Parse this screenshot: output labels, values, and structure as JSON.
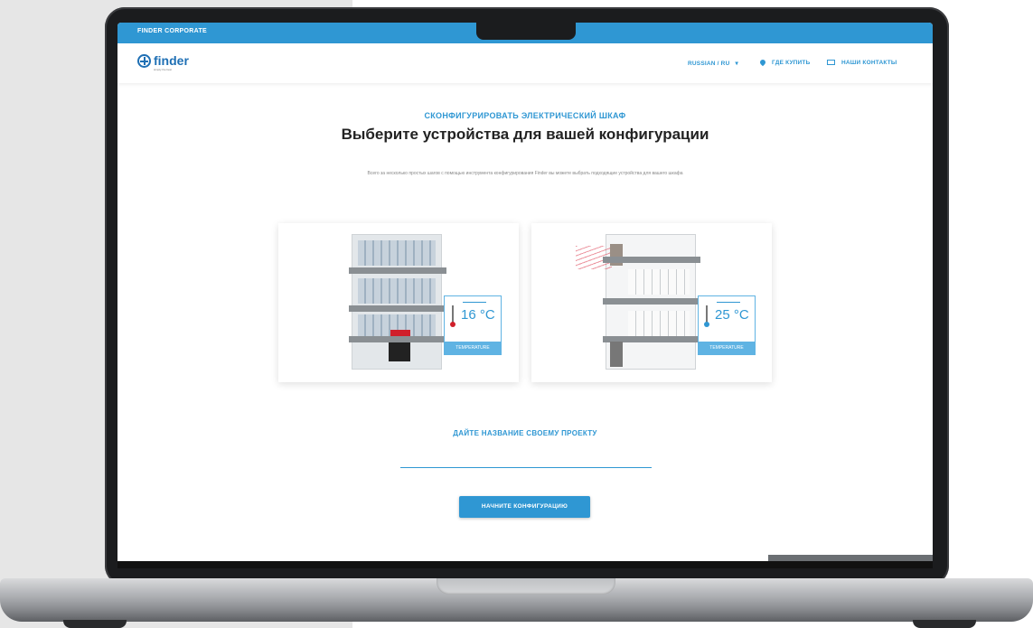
{
  "topbar": {
    "title": "FINDER CORPORATE"
  },
  "header": {
    "logo_text": "finder",
    "logo_tagline": "simply the best",
    "nav": {
      "language": "RUSSIAN / RU",
      "language_chevron": "▾",
      "where_to_buy": "ГДЕ КУПИТЬ",
      "contacts": "НАШИ КОНТАКТЫ"
    },
    "icons": {
      "pin": "location-pin-icon",
      "mail": "envelope-icon"
    }
  },
  "main": {
    "pretitle": "СКОНФИГУРИРОВАТЬ ЭЛЕКТРИЧЕСКИЙ ШКАФ",
    "title": "Выберите устройства для вашей конфигурации",
    "description": "Всего за несколько простых шагов с помощью инструмента конфигурирования Finder вы можете выбрать подходящие устройства для вашего шкафа",
    "options": [
      {
        "temperature": "16 °C",
        "label": "TEMPERATURE"
      },
      {
        "temperature": "25 °C",
        "label": "TEMPERATURE"
      }
    ],
    "project_name_label": "ДАЙТЕ НАЗВАНИЕ СВОЕМУ ПРОЕКТУ",
    "project_name_value": "",
    "start_button": "НАЧНИТЕ КОНФИГУРАЦИЮ"
  },
  "colors": {
    "accent": "#2f97d3",
    "brand": "#1e6fb4",
    "hot": "#d01f2a"
  }
}
